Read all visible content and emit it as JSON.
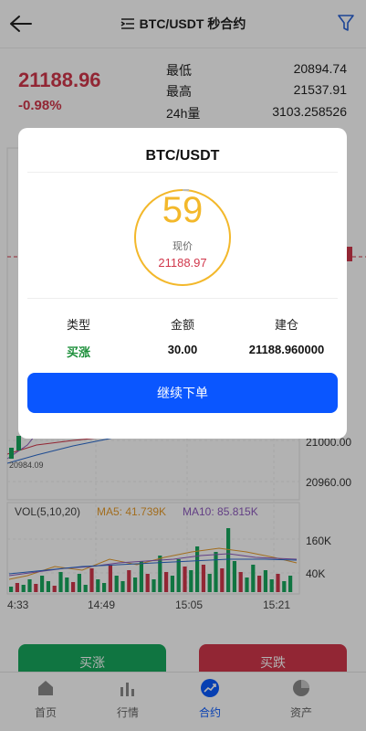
{
  "header": {
    "title": "BTC/USDT 秒合约",
    "back_icon": "arrow-left-icon",
    "title_icon": "menu-list-icon",
    "filter_icon": "filter-icon"
  },
  "ticker": {
    "last_price": "21188.96",
    "change": "-0.98%",
    "low_label": "最低",
    "low_value": "20894.74",
    "high_label": "最高",
    "high_value": "21537.91",
    "vol_label": "24h量",
    "vol_value": "3103.258526"
  },
  "chart": {
    "price_axis_labels": [
      "21000.00",
      "20960.00"
    ],
    "min_price_marker": "20984.09",
    "volume_legend": {
      "vol": "VOL(5,10,20)",
      "ma5": "MA5: 41.739K",
      "ma10": "MA10: 85.815K"
    },
    "volume_axis_labels": [
      "160K",
      "40K"
    ],
    "time_labels": [
      "4:33",
      "14:49",
      "15:05",
      "15:21"
    ],
    "colors": {
      "up": "#17a85e",
      "down": "#d1374b",
      "ma5": "#e89d2c",
      "ma10": "#8e5bbf",
      "ma20": "#2b6cd0"
    }
  },
  "actions": {
    "buy_up": "买涨",
    "buy_down": "买跌"
  },
  "nav": [
    {
      "label": "首页",
      "icon": "home-icon"
    },
    {
      "label": "行情",
      "icon": "bar-chart-icon"
    },
    {
      "label": "合约",
      "icon": "trend-icon",
      "active": true
    },
    {
      "label": "资产",
      "icon": "pie-chart-icon"
    }
  ],
  "modal": {
    "title": "BTC/USDT",
    "countdown": "59",
    "current_label": "现价",
    "current_price": "21188.97",
    "type_label": "类型",
    "amount_label": "金额",
    "open_label": "建仓",
    "type_value": "买涨",
    "amount_value": "30.00",
    "open_value": "21188.960000",
    "continue_label": "继续下单"
  }
}
